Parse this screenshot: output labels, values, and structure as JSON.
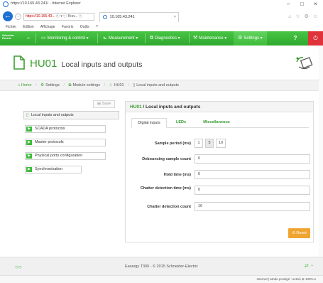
{
  "window": {
    "title": "https://10.165.43.241/ - Internet Explorer",
    "minimize": "–",
    "maximize": "□",
    "close": "×"
  },
  "browser": {
    "back": "←",
    "forward": "→",
    "address_prefix": "https://10.165.43...",
    "address_controls": "ⓧ ▾ ⓒ Brav... ⓒ",
    "tab_label": "10.165.43.241",
    "tab_close": "×",
    "toolbar_icons": "⌂ ☆ ⚙ ☺",
    "menu": [
      "Fichier",
      "Edition",
      "Affichage",
      "Favoris",
      "Outils",
      "?"
    ]
  },
  "navbar": {
    "logo": "Schneider Electric",
    "home_icon": "⌂",
    "items": [
      {
        "icon": "▭",
        "label": "Monitoring & control ▾"
      },
      {
        "icon": "⊾",
        "label": "Measurement ▾"
      },
      {
        "icon": "⧉",
        "label": "Diagnostics ▾"
      },
      {
        "icon": "⚒",
        "label": "Maintenance ▾"
      },
      {
        "icon": "⚙",
        "label": "Settings ▾"
      }
    ],
    "help": "?",
    "power": "⏻"
  },
  "header": {
    "code": "HU01",
    "title": "Local inputs and outputs"
  },
  "breadcrumb": {
    "home": "Home",
    "items": [
      "Settings",
      "Module settings",
      "HU01",
      "Local inputs and outputs"
    ]
  },
  "sidebar": {
    "save_label": "Save",
    "root": "Local inputs and outputs",
    "items": [
      "SCADA protocols",
      "Master protocols",
      "Physical ports configuration",
      "Synchronization"
    ]
  },
  "panel": {
    "title_code": "HU01",
    "title_text": "Local inputs and outputs",
    "tabs": [
      "Digital inputs",
      "LEDs",
      "Miscellaneous"
    ],
    "fields": {
      "sample_period": {
        "label": "Sample period (ms)",
        "options": [
          "1",
          "5",
          "10"
        ],
        "selected": "5"
      },
      "debounce": {
        "label": "Debouncing sample count",
        "value": "0"
      },
      "hold_time": {
        "label": "Hold time (ms)",
        "value": "0"
      },
      "chatter_time": {
        "label": "Chatter detection time (ms)",
        "value": "0"
      },
      "chatter_count": {
        "label": "Chatter detection count",
        "value": "16"
      }
    },
    "reset_label": "Reset"
  },
  "footer": {
    "copyright": "Easergy T300 - © 2015 Schneider-Electric",
    "status_left": "○○",
    "status_right": "⇄ ◔"
  },
  "statusbar": {
    "right": "Internet | Mode protégé : activé    ⊕ 100% ▾"
  },
  "colors": {
    "brand_green": "#3dbb3a",
    "title_green": "#3a9d2e",
    "reset_orange": "#f0a531",
    "power_red": "#e0323a"
  }
}
